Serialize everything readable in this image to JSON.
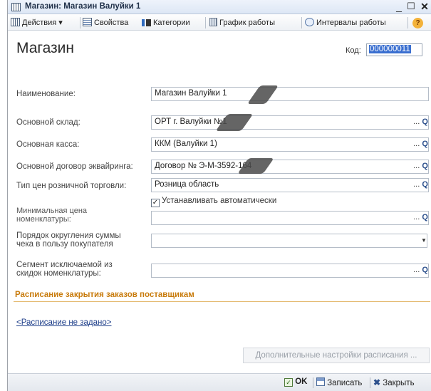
{
  "window": {
    "title": "Магазин: Магазин Валуйки 1",
    "minimize": "_",
    "maximize": "☐",
    "close": "✕"
  },
  "toolbar": {
    "actions": "Действия",
    "actions_arrow": "▾",
    "properties": "Свойства",
    "categories": "Категории",
    "schedule": "График работы",
    "intervals": "Интервалы работы",
    "help": "?"
  },
  "form": {
    "title": "Магазин",
    "kod_label": "Код:",
    "kod_value": "000000011",
    "fields": [
      {
        "label": "Наименование:",
        "value": "Магазин Валуйки 1"
      },
      {
        "label": "Основной склад:",
        "value": "ОРТ г. Валуйки №1"
      },
      {
        "label": "Основная касса:",
        "value": "ККМ (Валуйки 1)"
      },
      {
        "label": "Основной договор эквайринга:",
        "value": "Договор № Э-М-3592-164"
      },
      {
        "label": "Тип цен розничной торговли:",
        "value": "Розница область"
      },
      {
        "label_line1": "Минимальная цена",
        "label_line2": "номенклатуры:",
        "value": ""
      },
      {
        "label_line1": "Порядок округления суммы",
        "label_line2": "чека в пользу покупателя",
        "value": ""
      },
      {
        "label_line1": "Сегмент исключаемой из",
        "label_line2": "скидок номенклатуры:",
        "value": ""
      }
    ],
    "auto_set_label": "Устанавливать автоматически",
    "auto_set_checked": true,
    "select_btn": "...",
    "search_glyph": "Q",
    "dropdown_glyph": "▼"
  },
  "section": {
    "title": "Расписание закрытия заказов поставщикам",
    "schedule_link": "<Расписание не задано>",
    "extra_settings_button": "Дополнительные настройки расписания ..."
  },
  "footer": {
    "ok": "OK",
    "save": "Записать",
    "close": "Закрыть"
  },
  "colors": {
    "section_title": "#c87b0c",
    "kod_selection": "#3a6fd0"
  }
}
